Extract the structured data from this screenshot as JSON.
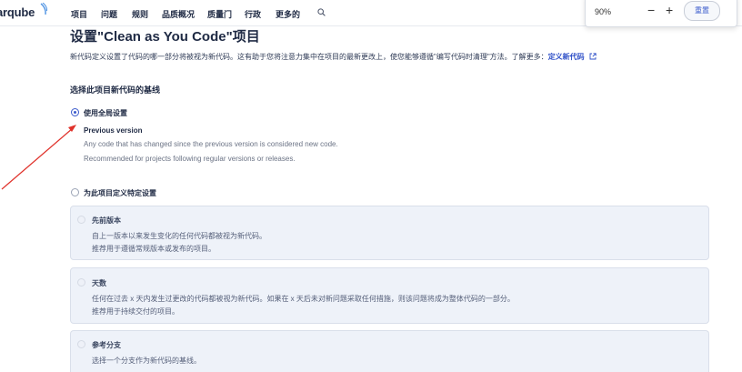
{
  "nav": {
    "logo": "arqube",
    "items": [
      "项目",
      "问题",
      "规则",
      "品质概况",
      "质量门",
      "行政",
      "更多的"
    ]
  },
  "zoom": {
    "value": "90%",
    "minus": "−",
    "plus": "+",
    "reset": "重置"
  },
  "page": {
    "title": "设置\"Clean as You Code\"项目",
    "description": "新代码定义设置了代码的哪一部分将被视为新代码。这有助于您将注意力集中在项目的最新更改上，使您能够遵循\"编写代码时清理\"方法。了解更多：",
    "description_link": "定义新代码",
    "section_title": "选择此项目新代码的基线"
  },
  "global_option": {
    "label": "使用全局设置",
    "previous_title": "Previous version",
    "line1": "Any code that has changed since the previous version is considered new code.",
    "line2": "Recommended for projects following regular versions or releases."
  },
  "specific_option": {
    "label": "为此项目定义特定设置"
  },
  "cards": [
    {
      "title": "先前版本",
      "line1": "自上一版本以来发生变化的任何代码都被视为新代码。",
      "line2": "推荐用于遵循常规版本或发布的项目。"
    },
    {
      "title": "天数",
      "line1": "任何在过去 x 天内发生过更改的代码都被视为新代码。如果在 x 天后未对新问题采取任何措施，则该问题将成为整体代码的一部分。",
      "line2": "推荐用于持续交付的项目。"
    },
    {
      "title": "参考分支",
      "line1": "选择一个分支作为新代码的基线。",
      "line2": ""
    }
  ],
  "colors": {
    "accent": "#3b5bcc",
    "link": "#2f50c8",
    "arrow": "#e0322b",
    "card_bg": "#eef2f9"
  }
}
